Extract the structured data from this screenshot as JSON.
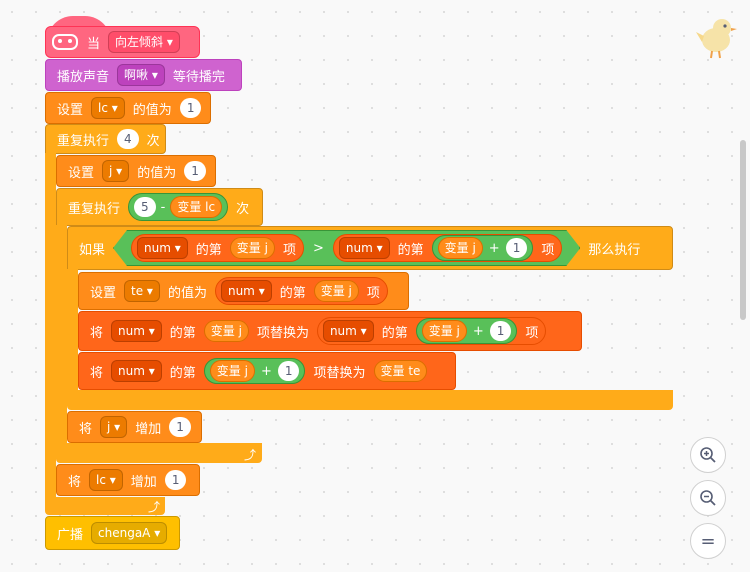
{
  "hat": {
    "label": "当",
    "dropdown": "向左倾斜"
  },
  "play_sound": {
    "label": "播放声音",
    "sound": "啊啾",
    "wait": "等待播完"
  },
  "set_lc": {
    "label": "设置",
    "var": "lc",
    "mid": "的值为",
    "value": "1"
  },
  "repeat_outer": {
    "label": "重复执行",
    "count": "4",
    "unit": "次"
  },
  "set_j": {
    "label": "设置",
    "var": "j",
    "mid": "的值为",
    "value": "1"
  },
  "repeat_inner": {
    "label": "重复执行",
    "a": "5",
    "op": "-",
    "var": "变量 lc",
    "unit": "次"
  },
  "if_block": {
    "label": "如果",
    "then": "那么执行",
    "gt": ">",
    "left": {
      "list": "num",
      "of": "的第",
      "var": "变量 j",
      "item": "项"
    },
    "right": {
      "list": "num",
      "of": "的第",
      "var": "变量 j",
      "plus": "+",
      "n": "1",
      "item": "项"
    }
  },
  "set_te": {
    "label": "设置",
    "var": "te",
    "mid": "的值为",
    "list": "num",
    "of": "的第",
    "idx": "变量 j",
    "item": "项"
  },
  "replace1": {
    "label": "将",
    "list": "num",
    "of": "的第",
    "idx": "变量 j",
    "replace": "项替换为",
    "list2": "num",
    "of2": "的第",
    "idx2": "变量 j",
    "plus": "+",
    "n": "1",
    "item": "项"
  },
  "replace2": {
    "label": "将",
    "list": "num",
    "of": "的第",
    "idx": "变量 j",
    "plus": "+",
    "n": "1",
    "replace": "项替换为",
    "value": "变量 te"
  },
  "change_j": {
    "label": "将",
    "var": "j",
    "mid": "增加",
    "value": "1"
  },
  "change_lc": {
    "label": "将",
    "var": "lc",
    "mid": "增加",
    "value": "1"
  },
  "broadcast": {
    "label": "广播",
    "message": "chengaA"
  },
  "controls": {
    "zoom_in": "+",
    "zoom_out": "−",
    "reset": "="
  },
  "colors": {
    "events": "#ffab19",
    "sound": "#cf63cf",
    "variables": "#ff8c1a",
    "control": "#ffab19",
    "operators": "#59c059",
    "pen": "#ff6680"
  }
}
